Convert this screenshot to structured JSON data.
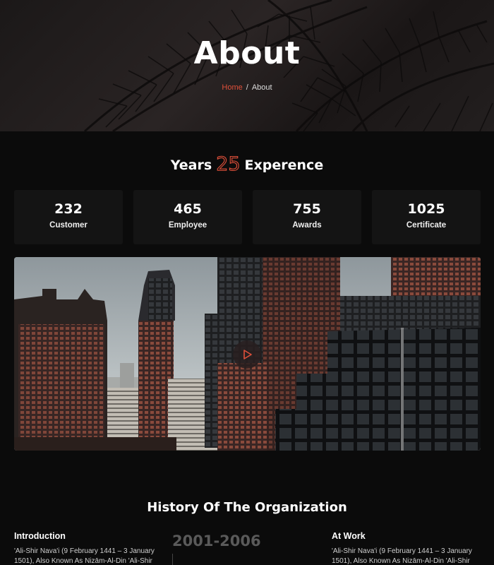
{
  "hero": {
    "title": "About",
    "breadcrumb": {
      "home": "Home",
      "separator": "/",
      "current": "About"
    }
  },
  "experience": {
    "prefix": "Years",
    "years": "25",
    "suffix": "Experence"
  },
  "stats": [
    {
      "value": "232",
      "label": "Customer"
    },
    {
      "value": "465",
      "label": "Employee"
    },
    {
      "value": "755",
      "label": "Awards"
    },
    {
      "value": "1025",
      "label": "Certificate"
    }
  ],
  "video": {
    "play_icon": "play-icon"
  },
  "history": {
    "title": "History Of The Organization",
    "left": {
      "title": "Introduction",
      "text": "'Ali-Shir Nava'i (9 February 1441 – 3 January 1501), Also Known As Nizām-Al-Din 'Ali-Shir"
    },
    "timeline": {
      "year": "2001-2006"
    },
    "right": {
      "title": "At Work",
      "text": "'Ali-Shir Nava'i (9 February 1441 – 3 January 1501), Also Known As Nizām-Al-Din 'Ali-Shir"
    }
  },
  "colors": {
    "accent": "#e0503a",
    "background": "#0b0b0b",
    "card": "#141414"
  }
}
